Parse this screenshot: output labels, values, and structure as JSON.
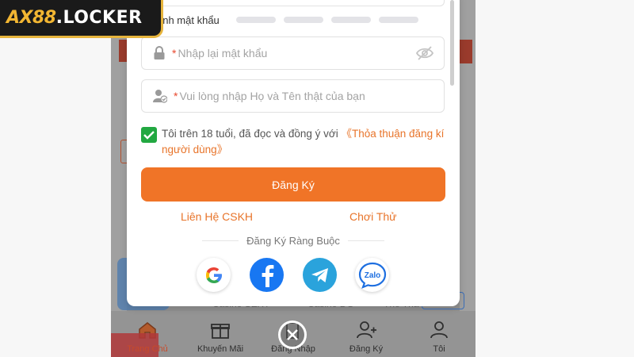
{
  "logo": {
    "brand": "AX88",
    "domain": ".LOCKER"
  },
  "form": {
    "strength_label": "ạnh mật khẩu",
    "confirm_password": {
      "required_mark": "*",
      "placeholder": "Nhập lại mật khẩu"
    },
    "full_name": {
      "required_mark": "*",
      "placeholder": "Vui lòng nhập Họ và Tên thật của bạn"
    },
    "agreement": {
      "checked": true,
      "text": "Tôi trên 18 tuổi, đã đọc và đồng ý với ",
      "link": "《Thỏa thuận đăng kí người dùng》"
    },
    "register_button": "Đăng Ký",
    "support_link": "Liên Hệ CSKH",
    "trial_link": "Chơi Thử",
    "social_heading": "Đăng Ký Ràng Buộc",
    "social": {
      "zalo_label": "Zalo"
    }
  },
  "background": {
    "ghost_labels": [
      "Casino SEXY",
      "Casino DG",
      "Thể Tha"
    ]
  },
  "bottom_nav": {
    "items": [
      {
        "label": "Trang Chủ",
        "icon": "home-icon"
      },
      {
        "label": "Khuyến Mãi",
        "icon": "gift-icon"
      },
      {
        "label": "Đăng Nhập",
        "icon": "login-icon"
      },
      {
        "label": "Đăng Ký",
        "icon": "add-user-icon"
      },
      {
        "label": "Tôi",
        "icon": "user-icon"
      }
    ]
  },
  "colors": {
    "accent": "#f07427",
    "checkbox": "#22a841",
    "facebook": "#1877f2",
    "telegram": "#2aa3dc",
    "logo_gold": "#f2b632"
  }
}
